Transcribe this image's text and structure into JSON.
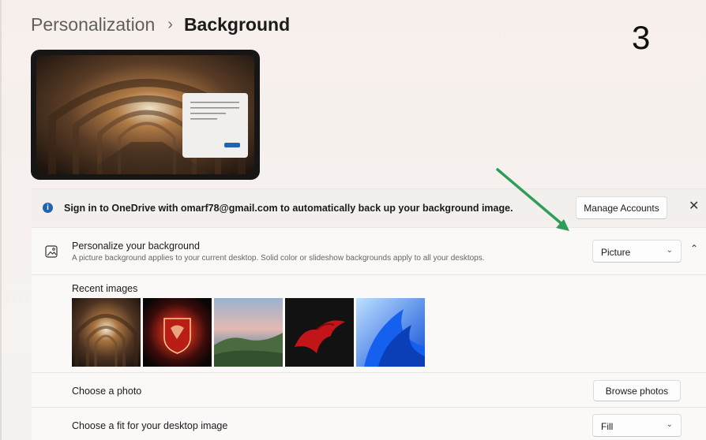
{
  "breadcrumb": {
    "parent": "Personalization",
    "separator": "›",
    "current": "Background"
  },
  "step_number": "3",
  "onedrive_banner": {
    "icon": "info-icon",
    "text": "Sign in to OneDrive with omarf78@gmail.com to automatically back up your background image.",
    "button_label": "Manage Accounts",
    "close_glyph": "✕"
  },
  "personalize": {
    "icon": "image-icon",
    "title": "Personalize your background",
    "subtitle": "A picture background applies to your current desktop. Solid color or slideshow backgrounds apply to all your desktops.",
    "selected": "Picture",
    "chevron": "⌄",
    "collapse_glyph": "⌃"
  },
  "recent": {
    "label": "Recent images",
    "images": [
      "brick-arches",
      "msi-red-shield",
      "coastal-town",
      "red-dragon",
      "blue-bloom"
    ]
  },
  "choose_photo": {
    "label": "Choose a photo",
    "button_label": "Browse photos"
  },
  "fit": {
    "label": "Choose a fit for your desktop image",
    "selected": "Fill",
    "chevron": "⌄"
  },
  "colors": {
    "accent": "#1f63b3",
    "arrow": "#2e9d57"
  }
}
